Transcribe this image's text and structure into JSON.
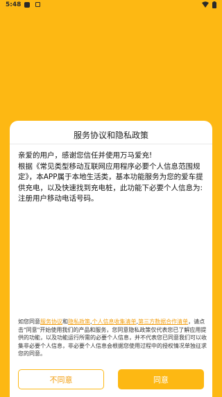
{
  "status_bar": {
    "time": "5:48",
    "icons": [
      "notification-square-icon",
      "notification-a-icon",
      "wifi-icon",
      "battery-icon"
    ]
  },
  "dialog": {
    "title": "服务协议和隐私政策",
    "body_line1": "亲爱的用户，感谢您信任并使用万马爱充!",
    "body_line2": "根据《常见类型移动互联网应用程序必要个人信息范围规定》，本APP属于本地生活类，基本功能服务为您的爱车提供充电，以及快速找到充电桩，此功能下必要个人信息为:注册用户移动电话号码。",
    "agreement": {
      "prefix": "如您同意",
      "link_service": "服务协议",
      "and": "和",
      "link_privacy": "隐私政策",
      "comma1": ",",
      "link_collection": "个人信息收集清单",
      "comma2": ",",
      "link_thirdparty": "第三方数据合作清单",
      "rest": "，请点击\"同意\"开始使用我们的产品和服务，您同意隐私政策仅代表您已了解应用提供的功能，以及功能运行所需的必要个人信息，并不代表您已同意我们可以收集非必要个人信息，非必要个人信息会根据您使用过程中的授权情况单独征求您的同意。"
    },
    "disagree_label": "不同意",
    "agree_label": "同意"
  },
  "colors": {
    "background": "#FDB813",
    "accent_text": "#F29D0D",
    "card": "#FFFFFF"
  }
}
